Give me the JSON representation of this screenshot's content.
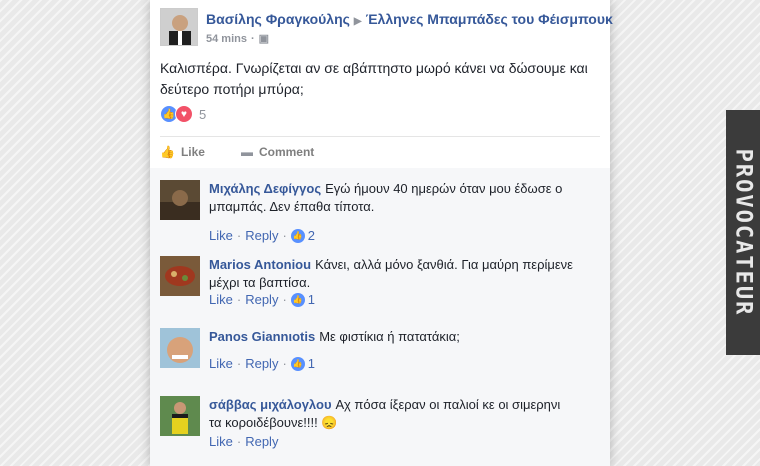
{
  "post": {
    "author": "Βασίλης Φραγκούλης",
    "group": "Έλληνες Μπαμπάδες του Φέισμπουκ",
    "time": "54 mins",
    "text_line1": "Καλισπέρα. Γνωρίζεται αν σε αβάπτηστο μωρό κάνει να δώσουμε και",
    "text_line2": "δεύτερο ποτήρι μπύρα;",
    "reaction_count": "5"
  },
  "actions": {
    "like": "Like",
    "comment": "Comment"
  },
  "comments": [
    {
      "author": "Μιχάλης Δεφίγγος",
      "line1": "Εγώ ήμουν 40 ημερών όταν μου έδωσε ο",
      "line2": "μπαμπάς. Δεν έπαθα τίποτα.",
      "like": "Like",
      "reply": "Reply",
      "likes": "2"
    },
    {
      "author": "Marios Antoniou",
      "line1": "Κάνει, αλλά μόνο ξανθιά. Για μαύρη περίμενε",
      "line2": "μέχρι τα βαπτίσα.",
      "like": "Like",
      "reply": "Reply",
      "likes": "1"
    },
    {
      "author": "Panos Giannιotis",
      "line1": "Με φιστίκια ή πατατάκια;",
      "line2": "",
      "like": "Like",
      "reply": "Reply",
      "likes": "1"
    },
    {
      "author": "σάββας μιχάλογλου",
      "line1": "Αχ πόσα ίξεραν οι παλιοί κε οι σιμερηνι",
      "line2": "τα κοροιδέβουνε!!!! 😞",
      "like": "Like",
      "reply": "Reply",
      "likes": ""
    }
  ],
  "watermark": "PROVOCATEUR",
  "colors": {
    "link": "#365899",
    "like_blue": "#5890ff",
    "love_red": "#f25268"
  }
}
